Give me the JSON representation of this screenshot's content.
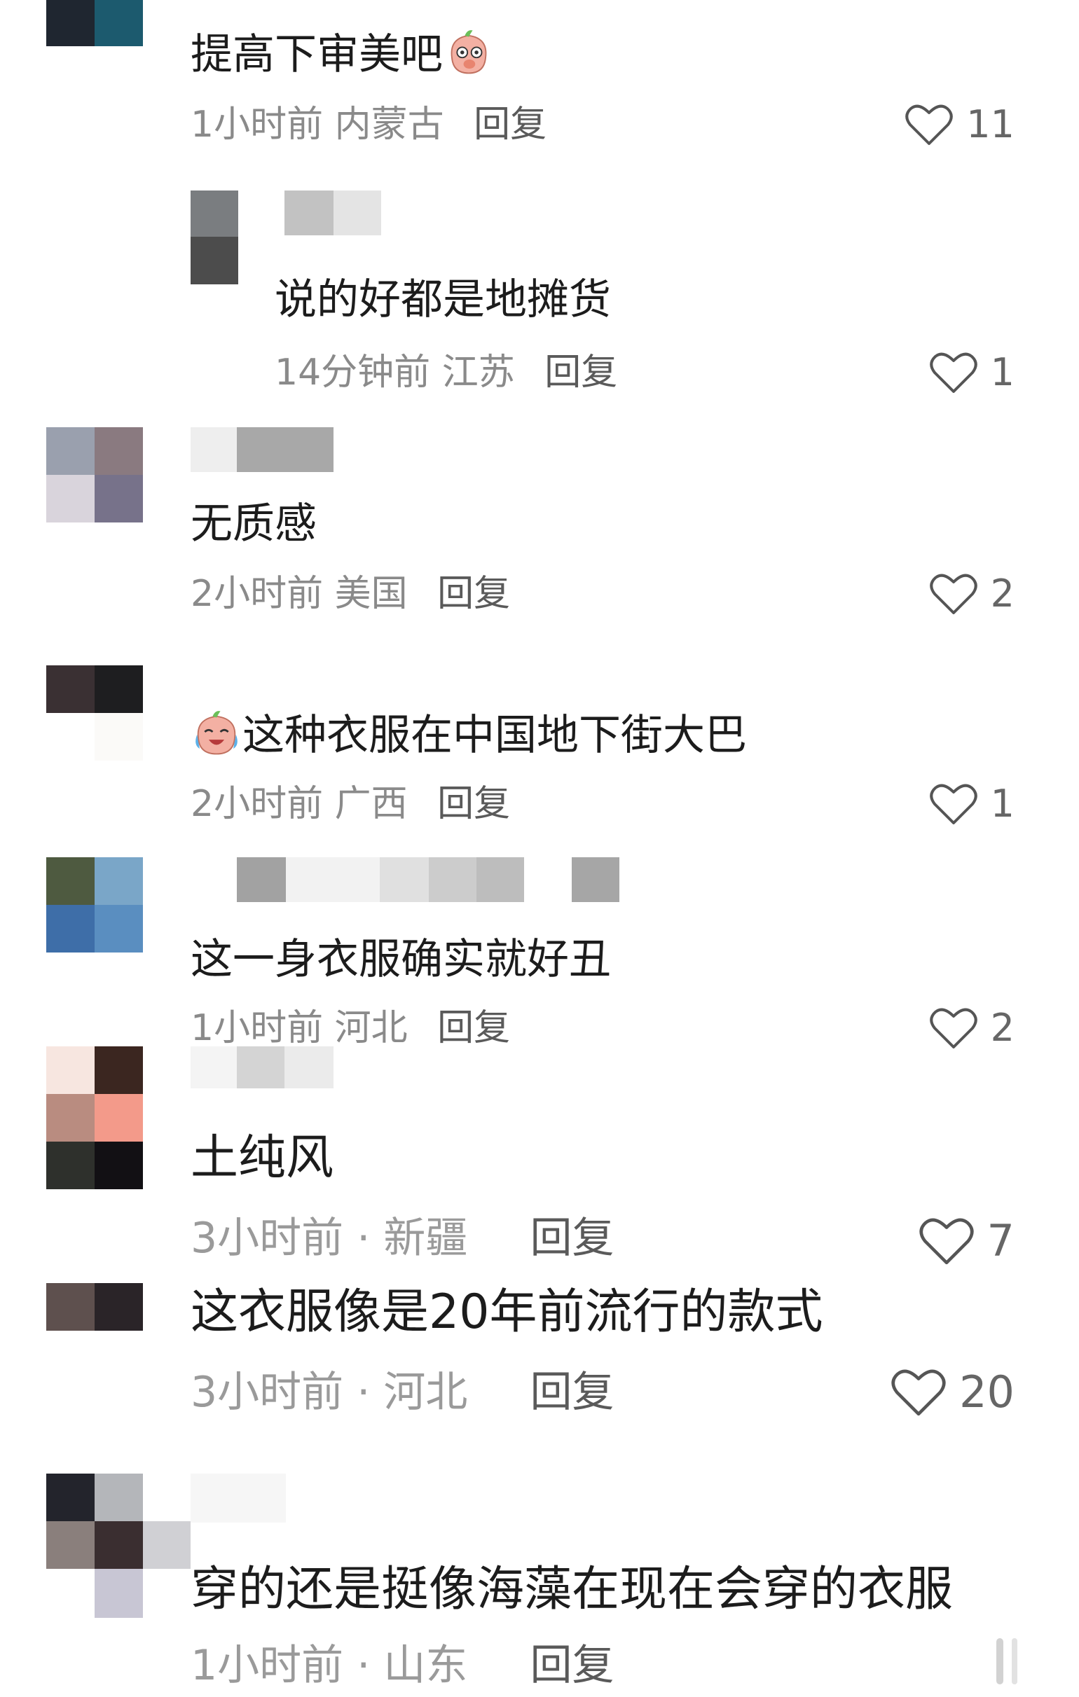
{
  "colors": {
    "text": "#1c1c1c",
    "meta": "#8a8a8a",
    "reply": "#5a5a5a",
    "heart": "#555555"
  },
  "comments": [
    {
      "text": "提高下审美吧",
      "emoji": "covering-mouth-emoji",
      "time": "1小时前",
      "location": "内蒙古",
      "reply": "回复",
      "likes": "11"
    },
    {
      "text": "说的好都是地摊货",
      "time": "14分钟前",
      "location": "江苏",
      "reply": "回复",
      "likes": "1"
    },
    {
      "text": "无质感",
      "time": "2小时前",
      "location": "美国",
      "reply": "回复",
      "likes": "2"
    },
    {
      "text": "这种衣服在中国地下街大巴",
      "emoji": "crying-laughing-emoji",
      "time": "2小时前",
      "location": "广西",
      "reply": "回复",
      "likes": "1"
    },
    {
      "text": "这一身衣服确实就好丑",
      "time": "1小时前",
      "location": "河北",
      "reply": "回复",
      "likes": "2"
    },
    {
      "text": "土纯风",
      "time": "3小时前",
      "location": "新疆",
      "reply": "回复",
      "likes": "7"
    },
    {
      "text": "这衣服像是20年前流行的款式",
      "time": "3小时前",
      "location": "河北",
      "reply": "回复",
      "likes": "20"
    },
    {
      "text": "穿的还是挺像海藻在现在会穿的衣服",
      "time": "1小时前",
      "location": "山东",
      "reply": "回复"
    }
  ]
}
